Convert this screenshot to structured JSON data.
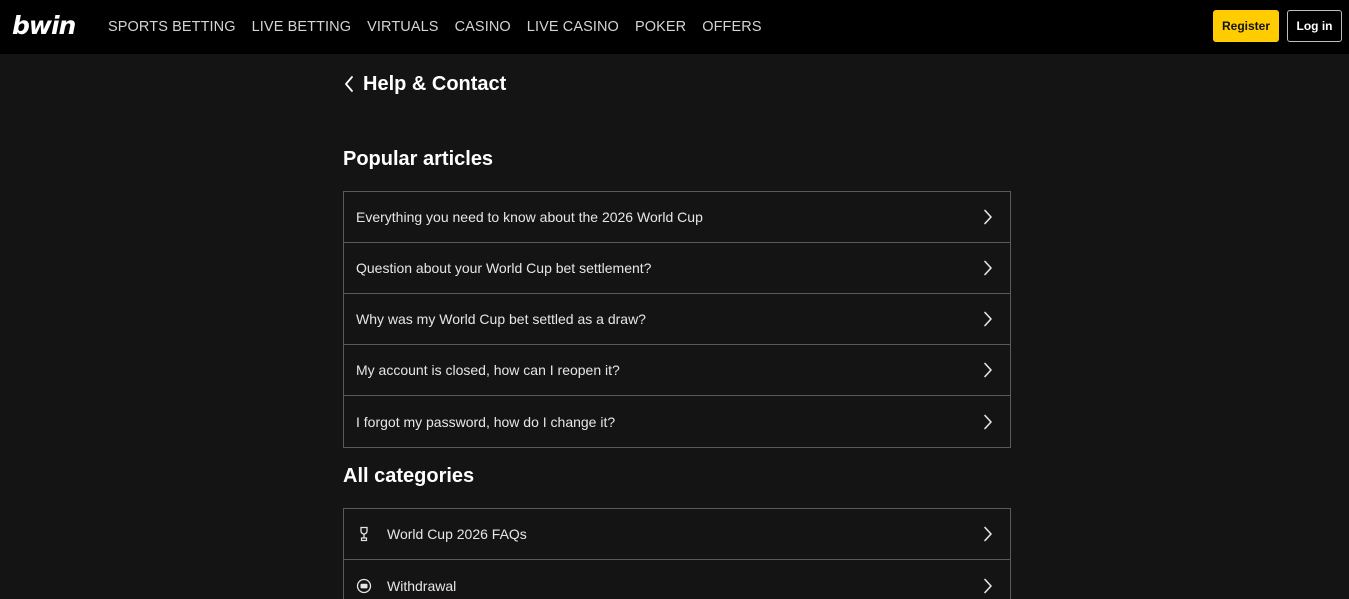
{
  "header": {
    "logo": "bwin",
    "nav": [
      "SPORTS BETTING",
      "LIVE BETTING",
      "VIRTUALS",
      "CASINO",
      "LIVE CASINO",
      "POKER",
      "OFFERS"
    ],
    "register_label": "Register",
    "login_label": "Log in"
  },
  "page": {
    "title": "Help & Contact"
  },
  "popular": {
    "title": "Popular articles",
    "items": [
      "Everything you need to know about the 2026 World Cup",
      "Question about your World Cup bet settlement?",
      "Why was my World Cup bet settled as a draw?",
      "My account is closed, how can I reopen it?",
      "I forgot my password, how do I change it?"
    ]
  },
  "categories": {
    "title": "All categories",
    "items": [
      {
        "label": "World Cup 2026 FAQs",
        "icon": "trophy-icon"
      },
      {
        "label": "Withdrawal",
        "icon": "wallet-icon"
      }
    ]
  },
  "colors": {
    "accent": "#ffcc00",
    "background": "#141414",
    "header": "#000000",
    "border": "#5a5a5a"
  }
}
